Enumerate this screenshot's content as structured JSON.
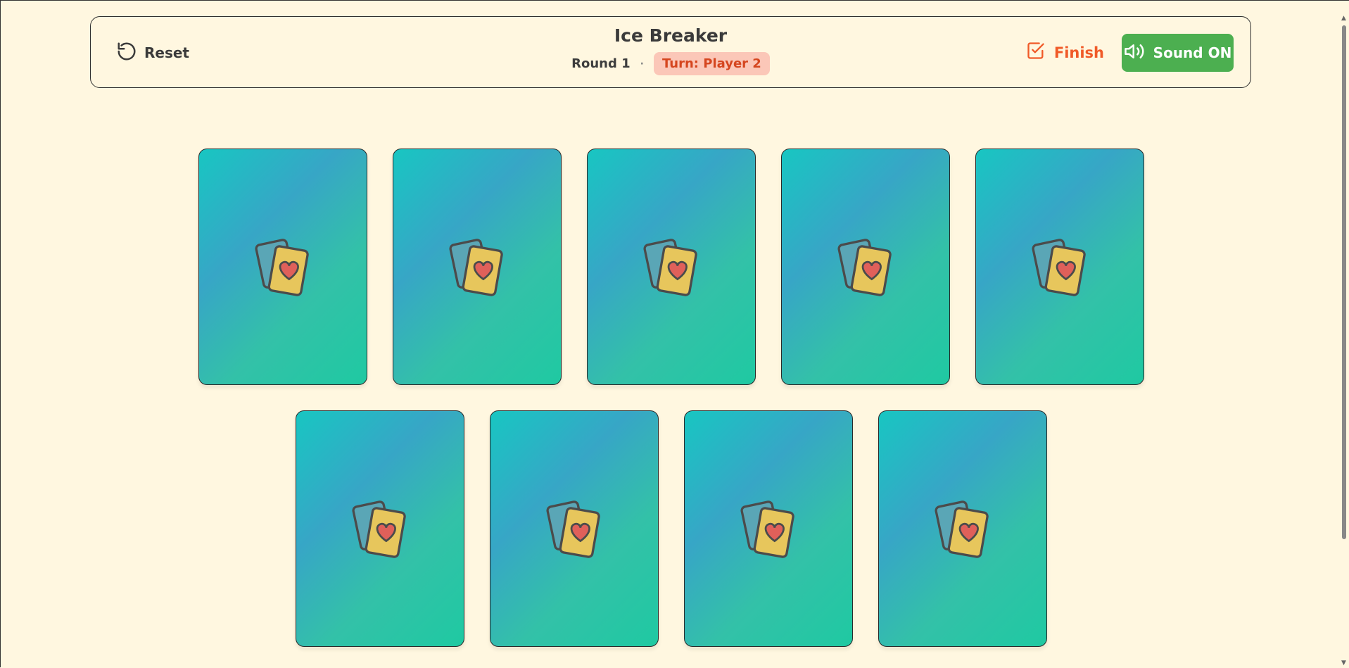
{
  "header": {
    "reset_label": "Reset",
    "title": "Ice Breaker",
    "round_label": "Round 1",
    "separator": "·",
    "turn_label": "Turn: Player 2",
    "finish_label": "Finish",
    "sound_label": "Sound ON"
  },
  "cards": [
    {
      "state": "face-down"
    },
    {
      "state": "face-down"
    },
    {
      "state": "face-down"
    },
    {
      "state": "face-down"
    },
    {
      "state": "face-down"
    },
    {
      "state": "face-down"
    },
    {
      "state": "face-down"
    },
    {
      "state": "face-down"
    },
    {
      "state": "face-down"
    }
  ],
  "colors": {
    "background": "#fff7e0",
    "turn_badge_bg": "#fbc7b8",
    "turn_badge_text": "#d5461f",
    "finish": "#f05a28",
    "sound_button": "#4caf50",
    "card_gradient_start": "#18c6c2",
    "card_gradient_end": "#1fc9a2"
  },
  "icons": {
    "reset": "refresh-ccw-icon",
    "finish": "check-square-icon",
    "sound": "volume-icon",
    "card_back": "playing-cards-heart-icon"
  }
}
